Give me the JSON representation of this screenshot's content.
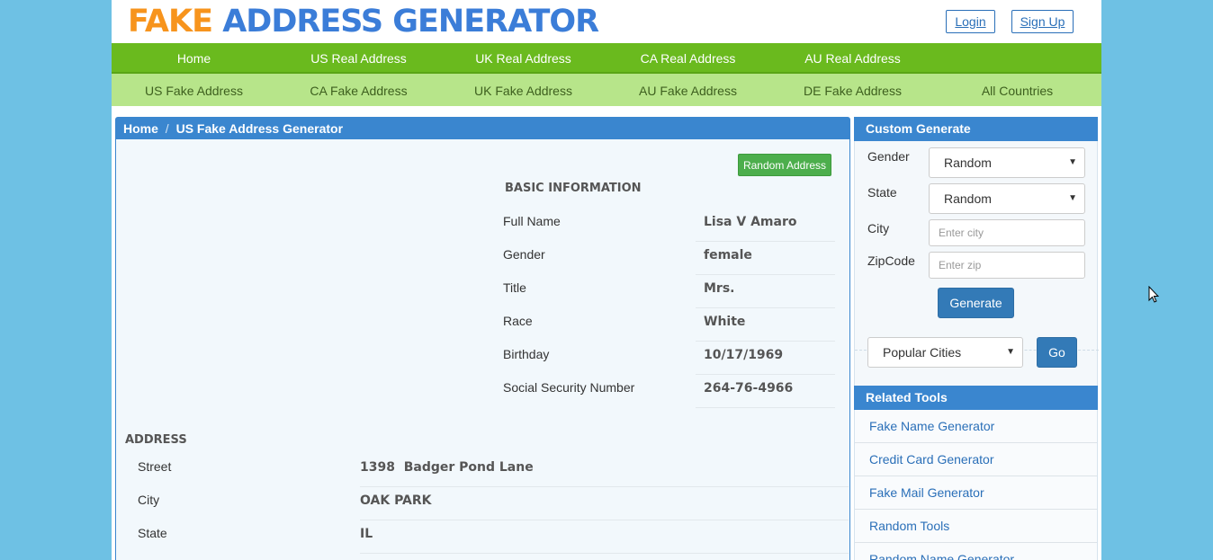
{
  "header": {
    "logo_part1": "FAKE",
    "logo_part2": "ADDRESS GENERATOR",
    "login_label": "Login",
    "signup_label": "Sign Up"
  },
  "nav_primary": [
    "Home",
    "US Real Address",
    "UK Real Address",
    "CA Real Address",
    "AU Real Address"
  ],
  "nav_secondary": [
    "US Fake Address",
    "CA Fake Address",
    "UK Fake Address",
    "AU Fake Address",
    "DE Fake Address",
    "All Countries"
  ],
  "breadcrumb": {
    "home": "Home",
    "separator": "/",
    "current": "US Fake Address Generator"
  },
  "main": {
    "random_button": "Random Address",
    "basic_title": "BASIC INFORMATION",
    "basic": [
      {
        "label": "Full Name",
        "value": "Lisa V Amaro"
      },
      {
        "label": "Gender",
        "value": "female"
      },
      {
        "label": "Title",
        "value": "Mrs."
      },
      {
        "label": "Race",
        "value": "White"
      },
      {
        "label": "Birthday",
        "value": "10/17/1969"
      },
      {
        "label": "Social Security Number",
        "value": "264-76-4966"
      }
    ],
    "address_title": "ADDRESS",
    "address": [
      {
        "label": "Street",
        "value": "1398  Badger Pond Lane"
      },
      {
        "label": "City",
        "value": "OAK PARK"
      },
      {
        "label": "State",
        "value": "IL"
      }
    ]
  },
  "custom": {
    "title": "Custom Generate",
    "gender_label": "Gender",
    "gender_value": "Random",
    "state_label": "State",
    "state_value": "Random",
    "city_label": "City",
    "city_placeholder": "Enter city",
    "zip_label": "ZipCode",
    "zip_placeholder": "Enter zip",
    "generate_button": "Generate",
    "popular_cities": "Popular Cities",
    "go_button": "Go"
  },
  "related": {
    "title": "Related Tools",
    "items": [
      "Fake Name Generator",
      "Credit Card Generator",
      "Fake Mail Generator",
      "Random Tools",
      "Random Name Generator"
    ]
  },
  "colors": {
    "background": "#6ec1e4",
    "nav_primary": "#6aba1e",
    "nav_secondary": "#b7e58a",
    "panel_header": "#3a86cf",
    "logo_orange": "#f7941d",
    "logo_blue": "#3b7dd8"
  }
}
